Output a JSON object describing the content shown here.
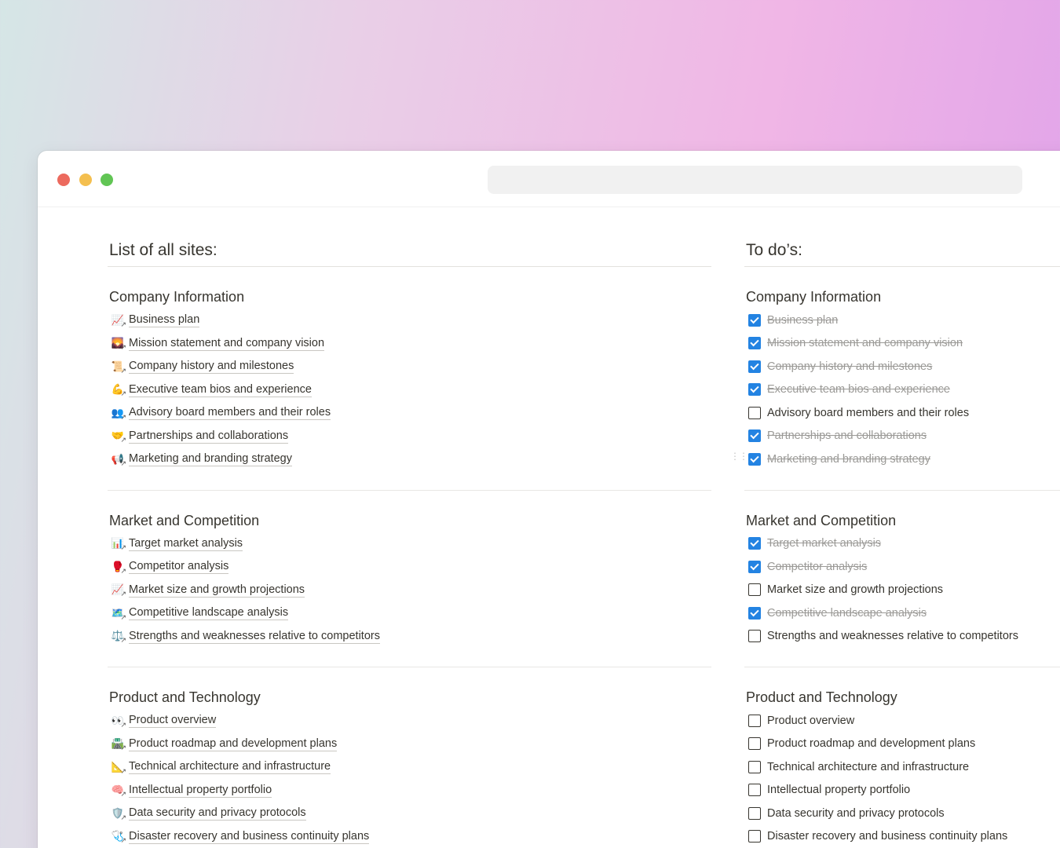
{
  "left": {
    "title": "List of all sites:",
    "sections": [
      {
        "title": "Company Information",
        "items": [
          {
            "label": "Business plan",
            "icon": "📈"
          },
          {
            "label": "Mission statement and company vision",
            "icon": "🌄"
          },
          {
            "label": "Company history and milestones",
            "icon": "📜"
          },
          {
            "label": "Executive team bios and experience",
            "icon": "💪"
          },
          {
            "label": "Advisory board members and their roles",
            "icon": "👥"
          },
          {
            "label": "Partnerships and collaborations",
            "icon": "🤝"
          },
          {
            "label": "Marketing and branding strategy",
            "icon": "📢"
          }
        ]
      },
      {
        "title": "Market and Competition",
        "items": [
          {
            "label": "Target market analysis",
            "icon": "📊"
          },
          {
            "label": "Competitor analysis",
            "icon": "🥊"
          },
          {
            "label": "Market size and growth projections",
            "icon": "📈"
          },
          {
            "label": "Competitive landscape analysis",
            "icon": "🗺️"
          },
          {
            "label": "Strengths and weaknesses relative to competitors",
            "icon": "⚖️"
          }
        ]
      },
      {
        "title": "Product and Technology",
        "items": [
          {
            "label": "Product overview",
            "icon": "👀"
          },
          {
            "label": "Product roadmap and development plans",
            "icon": "🛣️"
          },
          {
            "label": "Technical architecture and infrastructure",
            "icon": "📐"
          },
          {
            "label": "Intellectual property portfolio",
            "icon": "🧠"
          },
          {
            "label": "Data security and privacy protocols",
            "icon": "🛡️"
          },
          {
            "label": "Disaster recovery and business continuity plans",
            "icon": "🩺"
          }
        ]
      }
    ]
  },
  "right": {
    "title": "To do’s:",
    "sections": [
      {
        "title": "Company Information",
        "items": [
          {
            "label": "Business plan",
            "checked": true
          },
          {
            "label": "Mission statement and company vision",
            "checked": true
          },
          {
            "label": "Company history and milestones",
            "checked": true
          },
          {
            "label": "Executive team bios and experience",
            "checked": true
          },
          {
            "label": "Advisory board members and their roles",
            "checked": false
          },
          {
            "label": "Partnerships and collaborations",
            "checked": true
          },
          {
            "label": "Marketing and branding strategy",
            "checked": true
          }
        ]
      },
      {
        "title": "Market and Competition",
        "items": [
          {
            "label": "Target market analysis",
            "checked": true
          },
          {
            "label": "Competitor analysis",
            "checked": true
          },
          {
            "label": "Market size and growth projections",
            "checked": false
          },
          {
            "label": "Competitive landscape analysis",
            "checked": true
          },
          {
            "label": "Strengths and weaknesses relative to competitors",
            "checked": false
          }
        ]
      },
      {
        "title": "Product and Technology",
        "items": [
          {
            "label": "Product overview",
            "checked": false
          },
          {
            "label": "Product roadmap and development plans",
            "checked": false
          },
          {
            "label": "Technical architecture and infrastructure",
            "checked": false
          },
          {
            "label": "Intellectual property portfolio",
            "checked": false
          },
          {
            "label": "Data security and privacy protocols",
            "checked": false
          },
          {
            "label": "Disaster recovery and business continuity plans",
            "checked": false
          }
        ]
      }
    ]
  },
  "colors": {
    "check_on": "#2383e2",
    "text": "#37352f",
    "muted": "#9b9a97"
  }
}
